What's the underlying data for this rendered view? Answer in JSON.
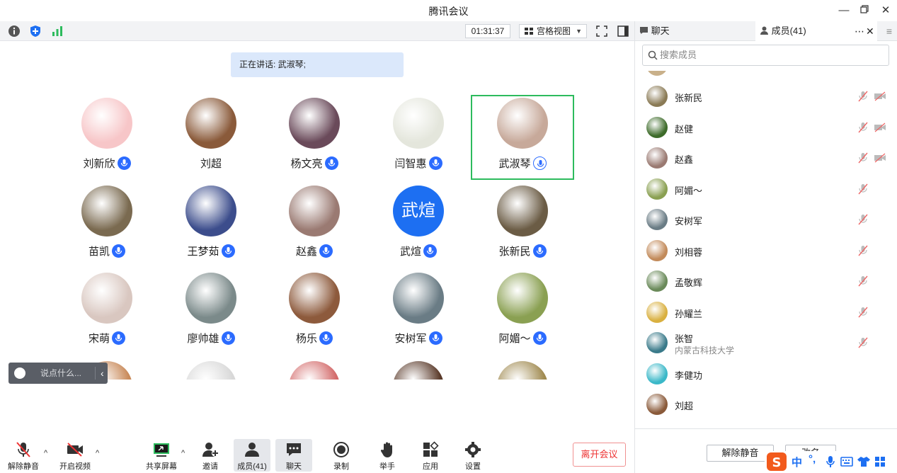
{
  "window": {
    "title": "腾讯会议"
  },
  "toolbar_top": {
    "timer": "01:31:37",
    "view_label": "宫格视图"
  },
  "speaking": "正在讲话: 武淑琴;",
  "participants": [
    {
      "name": "刘新欣",
      "mic": true,
      "color": "#f7c6c8"
    },
    {
      "name": "刘超",
      "mic": false,
      "color": "#8a5a3a"
    },
    {
      "name": "杨文亮",
      "mic": true,
      "color": "#6a4a5a"
    },
    {
      "name": "闫智惠",
      "mic": true,
      "color": "#e4e6dc"
    },
    {
      "name": "武淑琴",
      "mic": true,
      "color": "#c7a99a",
      "active": true
    },
    {
      "name": "苗凯",
      "mic": true,
      "color": "#7a6a50"
    },
    {
      "name": "王梦茹",
      "mic": true,
      "color": "#3c4d8c"
    },
    {
      "name": "赵鑫",
      "mic": true,
      "color": "#9a7a72"
    },
    {
      "name": "武煊",
      "mic": true,
      "color": "#1d6ff2",
      "initials": "武煊"
    },
    {
      "name": "张新民",
      "mic": true,
      "color": "#6b5c45"
    },
    {
      "name": "宋萌",
      "mic": true,
      "color": "#d9c7c0"
    },
    {
      "name": "廖帅雄",
      "mic": true,
      "color": "#7b8a8a"
    },
    {
      "name": "杨乐",
      "mic": true,
      "color": "#8d5a3c"
    },
    {
      "name": "安树军",
      "mic": true,
      "color": "#6a7c85"
    },
    {
      "name": "阿媚～",
      "mic": true,
      "color": "#8aa052"
    }
  ],
  "partial_colors": [
    "#c98a5a",
    "#d8d8d8",
    "#d36a6a",
    "#5a3a2a",
    "#a08a50"
  ],
  "chat_popup": {
    "placeholder": "说点什么..."
  },
  "bottom_toolbar": {
    "unmute": "解除静音",
    "video": "开启视频",
    "share": "共享屏幕",
    "invite": "邀请",
    "members": "成员(41)",
    "chat": "聊天",
    "record": "录制",
    "raise_hand": "举手",
    "apps": "应用",
    "settings": "设置",
    "leave": "离开会议"
  },
  "right_panel": {
    "tab_chat": "聊天",
    "tab_members": "成员(41)",
    "search_placeholder": "搜索成员",
    "members": [
      {
        "name": "张新民",
        "color": "#8a7a55",
        "cam": true
      },
      {
        "name": "赵健",
        "color": "#3d6b2a",
        "cam": true
      },
      {
        "name": "赵鑫",
        "color": "#9a7a72",
        "cam": true
      },
      {
        "name": "阿媚～",
        "color": "#8aa052",
        "cam": false
      },
      {
        "name": "安树军",
        "color": "#6a7c85",
        "cam": false
      },
      {
        "name": "刘相蓉",
        "color": "#c28a5a",
        "cam": false
      },
      {
        "name": "孟敬辉",
        "color": "#6a8a5a",
        "cam": false
      },
      {
        "name": "孙耀兰",
        "color": "#d9b040",
        "cam": false
      },
      {
        "name": "张智",
        "sub": "内蒙古科技大学",
        "color": "#3a7a8a",
        "cam": false
      },
      {
        "name": "李健功",
        "color": "#3bb8c8",
        "cam": false,
        "nomute": true
      },
      {
        "name": "刘超",
        "color": "#8a5a3a",
        "cam": false,
        "nomute": true
      }
    ],
    "btn_unmute": "解除静音",
    "btn_rename": "改名"
  },
  "ime": {
    "lang": "中"
  }
}
